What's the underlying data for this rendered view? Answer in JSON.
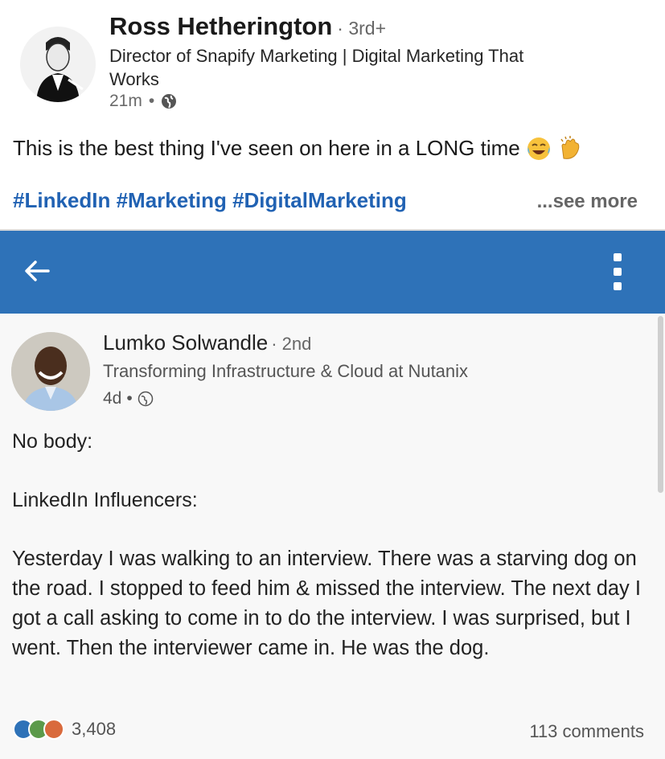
{
  "post": {
    "author_name": "Ross Hetherington",
    "author_degree": "· 3rd+",
    "author_headline": "Director of Snapify Marketing | Digital Marketing That Works",
    "time": "21m",
    "separator": "•",
    "text": "This is the best thing I've seen on here in a LONG time",
    "emojis": [
      "tears-of-joy-icon",
      "clapping-hands-icon"
    ],
    "hashtags": "#LinkedIn #Marketing #DigitalMarketing",
    "see_more": "...see more"
  },
  "embedded": {
    "appbar_color": "#2e72b8",
    "author_name": "Lumko Solwandle",
    "author_degree": "· 2nd",
    "author_headline": "Transforming Infrastructure & Cloud at Nutanix",
    "time": "4d",
    "separator": "•",
    "line1": "No body:",
    "line2": "LinkedIn Influencers:",
    "body": "Yesterday I was walking to an interview. There was a starving dog on the road. I stopped to feed him & missed the interview. The next day I got a call asking to come in to do the interview. I was surprised, but I went. Then the interviewer came in. He was the dog.",
    "reaction_count": "3,408",
    "comments": "113 comments",
    "reaction_icons": [
      "like-icon",
      "celebrate-icon",
      "love-icon"
    ]
  },
  "colors": {
    "link": "#2162b3",
    "like": "#2e72b8",
    "celebrate": "#5c9a4a",
    "love": "#d96a3c"
  }
}
